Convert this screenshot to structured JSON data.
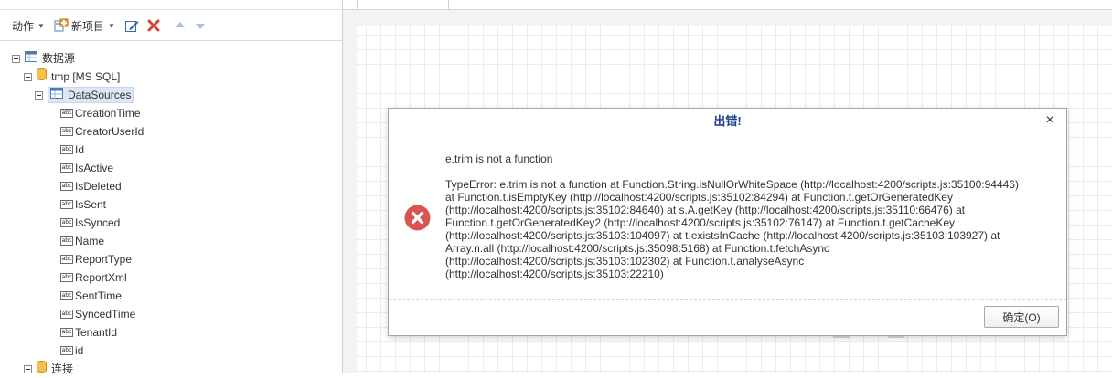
{
  "toolbar": {
    "actions_label": "动作",
    "new_item_label": "新项目"
  },
  "tree": {
    "root_label": "数据源",
    "connection_label": "tmp [MS SQL]",
    "table_label": "DataSources",
    "fields": [
      "CreationTime",
      "CreatorUserId",
      "Id",
      "IsActive",
      "IsDeleted",
      "IsSent",
      "IsSynced",
      "Name",
      "ReportType",
      "ReportXml",
      "SentTime",
      "SyncedTime",
      "TenantId",
      "id"
    ],
    "connections_label": "连接"
  },
  "dialog": {
    "title": "出错!",
    "close_glyph": "×",
    "message": "e.trim is not a function",
    "detail": "TypeError: e.trim is not a function at Function.String.isNullOrWhiteSpace (http://localhost:4200/scripts.js:35100:94446)\nat Function.t.isEmptyKey (http://localhost:4200/scripts.js:35102:84294) at Function.t.getOrGeneratedKey\n(http://localhost:4200/scripts.js:35102:84640) at s.A.getKey (http://localhost:4200/scripts.js:35110:66476) at\nFunction.t.getOrGeneratedKey2 (http://localhost:4200/scripts.js:35102:76147) at Function.t.getCacheKey\n(http://localhost:4200/scripts.js:35103:104097) at t.existsInCache (http://localhost:4200/scripts.js:35103:103927) at\nArray.n.all (http://localhost:4200/scripts.js:35098:5168) at Function.t.fetchAsync\n(http://localhost:4200/scripts.js:35103:102302) at Function.t.analyseAsync\n(http://localhost:4200/scripts.js:35103:22210)",
    "ok_label": "确定(O)"
  },
  "colors": {
    "title_blue": "#1a3c8a",
    "error_red": "#d9534f",
    "selected_bg": "#dce6f4"
  }
}
